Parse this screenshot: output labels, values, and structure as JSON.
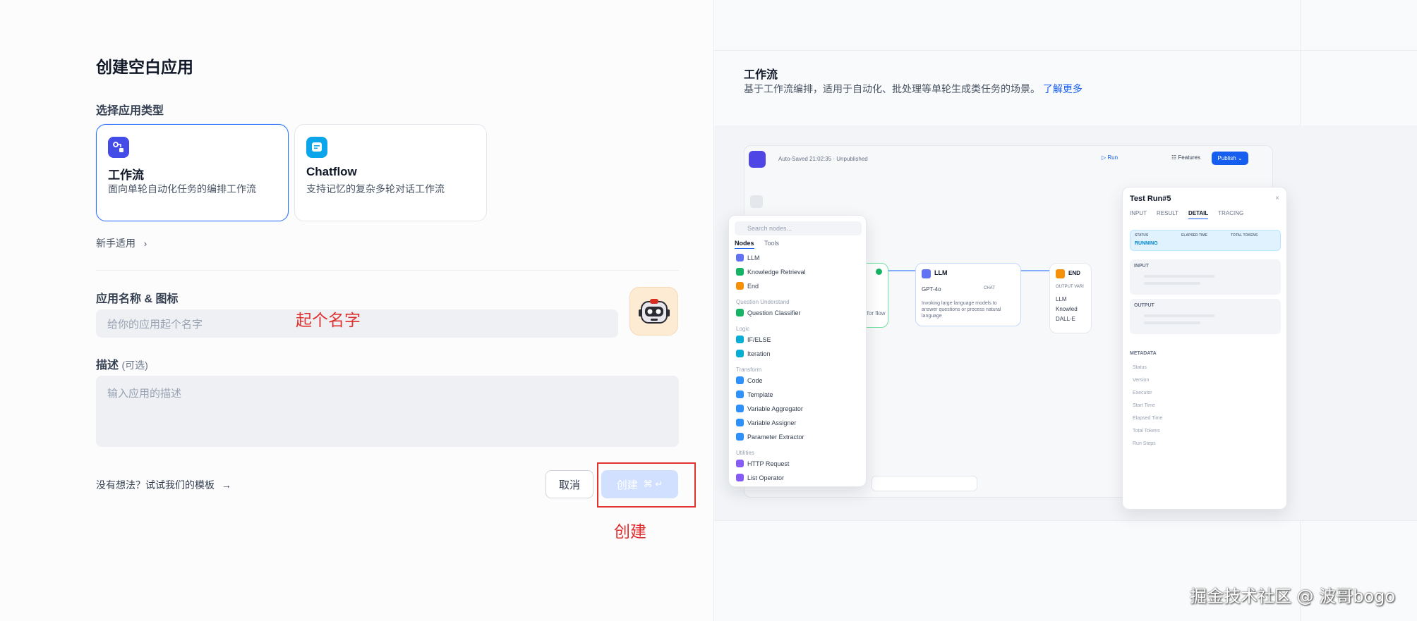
{
  "form": {
    "title": "创建空白应用",
    "type_label": "选择应用类型",
    "types": [
      {
        "name": "工作流",
        "desc": "面向单轮自动化任务的编排工作流",
        "color": "#444ce7"
      },
      {
        "name": "Chatflow",
        "desc": "支持记忆的复杂多轮对话工作流",
        "color": "#0ba5ec"
      }
    ],
    "beginner_label": "新手适用",
    "name_label": "应用名称 & 图标",
    "name_placeholder": "给你的应用起个名字",
    "desc_label": "描述",
    "desc_optional": "(可选)",
    "desc_placeholder": "输入应用的描述",
    "template_link": "没有想法？试试我们的模板",
    "cancel_label": "取消",
    "create_label": "创建"
  },
  "annotations": {
    "name_hint": "起个名字",
    "create_hint": "创建"
  },
  "info": {
    "title": "工作流",
    "desc": "基于工作流编排，适用于自动化、批处理等单轮生成类任务的场景。",
    "learn_more": "了解更多"
  },
  "preview": {
    "autosave": "Auto-Saved 21:02:35 · Unpublished",
    "run": "Run",
    "features": "Features",
    "publish": "Publish",
    "llm_node": {
      "title": "LLM",
      "model": "GPT-4o",
      "mode": "CHAT",
      "desc": "Invoking large language models to answer questions or process natural language"
    },
    "start_node_desc": "parameters for flow",
    "end_node": {
      "title": "END",
      "label": "OUTPUT VARI",
      "items": [
        "LLM",
        "Knowled",
        "DALL-E"
      ]
    },
    "palette": {
      "search": "Search nodes...",
      "tabs": [
        "Nodes",
        "Tools"
      ],
      "groups": [
        {
          "label": "",
          "items": [
            {
              "name": "LLM",
              "color": "#6172f3"
            },
            {
              "name": "Knowledge Retrieval",
              "color": "#16b364"
            },
            {
              "name": "End",
              "color": "#f79009"
            }
          ]
        },
        {
          "label": "Question Understand",
          "items": [
            {
              "name": "Question Classifier",
              "color": "#16b364"
            }
          ]
        },
        {
          "label": "Logic",
          "items": [
            {
              "name": "IF/ELSE",
              "color": "#06aed4"
            },
            {
              "name": "Iteration",
              "color": "#06aed4"
            }
          ]
        },
        {
          "label": "Transform",
          "items": [
            {
              "name": "Code",
              "color": "#2e90fa"
            },
            {
              "name": "Template",
              "color": "#2e90fa"
            },
            {
              "name": "Variable Aggregator",
              "color": "#2e90fa"
            },
            {
              "name": "Variable Assigner",
              "color": "#2e90fa"
            },
            {
              "name": "Parameter Extractor",
              "color": "#2e90fa"
            }
          ]
        },
        {
          "label": "Utilities",
          "items": [
            {
              "name": "HTTP Request",
              "color": "#875bf7"
            },
            {
              "name": "List Operator",
              "color": "#875bf7"
            }
          ]
        }
      ]
    },
    "test_run": {
      "title": "Test Run#5",
      "tabs": [
        "INPUT",
        "RESULT",
        "DETAIL",
        "TRACING"
      ],
      "status_cols": [
        "STATUS",
        "ELAPSED TIME",
        "TOTAL TOKENS"
      ],
      "status_value": "RUNNING",
      "input_label": "INPUT",
      "output_label": "OUTPUT",
      "metadata_label": "METADATA",
      "meta_rows": [
        "Status",
        "Version",
        "Executor",
        "Start Time",
        "Elapsed Time",
        "Total Tokens",
        "Run Steps"
      ]
    }
  },
  "watermark": "掘金技术社区 @ 波哥bogo"
}
